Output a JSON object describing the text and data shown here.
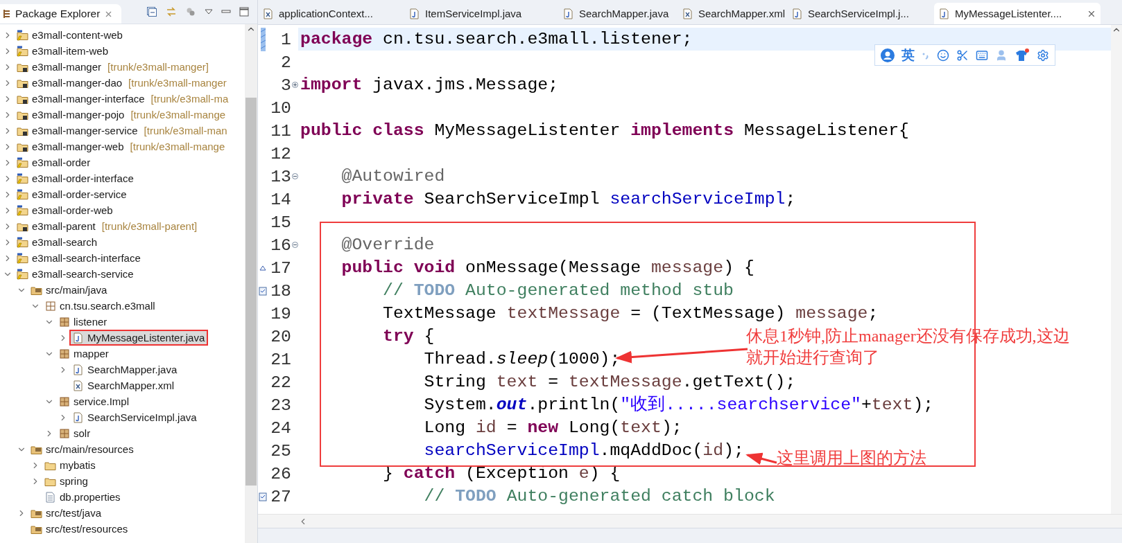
{
  "explorer": {
    "title": "Package Explorer",
    "tree": [
      {
        "label": "e3mall-content-web",
        "kind": "maven-project",
        "expanded": false
      },
      {
        "label": "e3mall-item-web",
        "kind": "maven-project",
        "expanded": false
      },
      {
        "label": "e3mall-manger",
        "decoration": "[trunk/e3mall-manger]",
        "kind": "svn-project",
        "expanded": false
      },
      {
        "label": "e3mall-manger-dao",
        "decoration": "[trunk/e3mall-manger",
        "kind": "svn-project",
        "expanded": false
      },
      {
        "label": "e3mall-manger-interface",
        "decoration": "[trunk/e3mall-ma",
        "kind": "svn-project",
        "expanded": false
      },
      {
        "label": "e3mall-manger-pojo",
        "decoration": "[trunk/e3mall-mange",
        "kind": "svn-project",
        "expanded": false
      },
      {
        "label": "e3mall-manger-service",
        "decoration": "[trunk/e3mall-man",
        "kind": "svn-project",
        "expanded": false
      },
      {
        "label": "e3mall-manger-web",
        "decoration": "[trunk/e3mall-mange",
        "kind": "svn-project",
        "expanded": false
      },
      {
        "label": "e3mall-order",
        "kind": "maven-project",
        "expanded": false
      },
      {
        "label": "e3mall-order-interface",
        "kind": "maven-project",
        "expanded": false
      },
      {
        "label": "e3mall-order-service",
        "kind": "maven-project",
        "expanded": false
      },
      {
        "label": "e3mall-order-web",
        "kind": "maven-project",
        "expanded": false
      },
      {
        "label": "e3mall-parent",
        "decoration": "[trunk/e3mall-parent]",
        "kind": "svn-project",
        "expanded": false
      },
      {
        "label": "e3mall-search",
        "kind": "maven-project",
        "expanded": false
      },
      {
        "label": "e3mall-search-interface",
        "kind": "maven-project",
        "expanded": false
      },
      {
        "label": "e3mall-search-service",
        "kind": "maven-project",
        "expanded": true,
        "children": [
          {
            "label": "src/main/java",
            "kind": "source-folder",
            "expanded": true,
            "children": [
              {
                "label": "cn.tsu.search.e3mall",
                "kind": "package-root",
                "expanded": true,
                "children": [
                  {
                    "label": "listener",
                    "kind": "package",
                    "expanded": true,
                    "children": [
                      {
                        "label": "MyMessageListenter.java",
                        "kind": "java",
                        "expanded": false,
                        "selected": true,
                        "boxed": true
                      }
                    ]
                  },
                  {
                    "label": "mapper",
                    "kind": "package",
                    "expanded": true,
                    "children": [
                      {
                        "label": "SearchMapper.java",
                        "kind": "java",
                        "expanded": false,
                        "selected": false,
                        "boxed": false
                      },
                      {
                        "label": "SearchMapper.xml",
                        "kind": "xml",
                        "selected": false,
                        "boxed": false
                      }
                    ]
                  },
                  {
                    "label": "service.Impl",
                    "kind": "package",
                    "expanded": true,
                    "children": [
                      {
                        "label": "SearchServiceImpl.java",
                        "kind": "java",
                        "expanded": false,
                        "selected": false,
                        "boxed": false
                      }
                    ]
                  },
                  {
                    "label": "solr",
                    "kind": "package",
                    "expanded": false
                  }
                ]
              }
            ]
          },
          {
            "label": "src/main/resources",
            "kind": "source-folder",
            "expanded": true,
            "children": [
              {
                "label": "mybatis",
                "kind": "folder",
                "expanded": false
              },
              {
                "label": "spring",
                "kind": "folder",
                "expanded": false
              },
              {
                "label": "db.properties",
                "kind": "file"
              }
            ]
          },
          {
            "label": "src/test/java",
            "kind": "source-folder",
            "expanded": false
          },
          {
            "label": "src/test/resources",
            "kind": "source-folder"
          }
        ]
      }
    ]
  },
  "editor": {
    "tabs": [
      {
        "label": "applicationContext...",
        "kind": "xml",
        "selected": false
      },
      {
        "label": "ItemServiceImpl.java",
        "kind": "java",
        "selected": false
      },
      {
        "label": "SearchMapper.java",
        "kind": "java",
        "selected": false
      },
      {
        "label": "SearchMapper.xml",
        "kind": "xml",
        "selected": false
      },
      {
        "label": "SearchServiceImpl.j...",
        "kind": "java",
        "selected": false
      },
      {
        "label": "MyMessageListenter....",
        "kind": "java",
        "selected": true
      }
    ],
    "lines": [
      {
        "number": "1",
        "current": true,
        "tokens": [
          {
            "text": "package",
            "kind": "keyword"
          },
          {
            "text": " cn.tsu.search.e3mall.listener;",
            "kind": "plain"
          }
        ]
      },
      {
        "number": "2",
        "current": false
      },
      {
        "number": "3",
        "current": false,
        "folded": true,
        "tokens": [
          {
            "text": "import",
            "kind": "keyword"
          },
          {
            "text": " javax.jms.Message;",
            "kind": "plain"
          }
        ]
      },
      {
        "number": "10",
        "current": false
      },
      {
        "number": "11",
        "current": false,
        "tokens": [
          {
            "text": "public class",
            "kind": "keyword"
          },
          {
            "text": " MyMessageListenter ",
            "kind": "plain"
          },
          {
            "text": "implements",
            "kind": "keyword"
          },
          {
            "text": " MessageListener{",
            "kind": "plain"
          }
        ]
      },
      {
        "number": "12",
        "current": false
      },
      {
        "number": "13",
        "current": false,
        "folded": false,
        "tokens": [
          {
            "text": "    @Autowired",
            "kind": "annotation"
          }
        ]
      },
      {
        "number": "14",
        "current": false,
        "tokens": [
          {
            "text": "    private",
            "kind": "keyword"
          },
          {
            "text": " SearchServiceImpl ",
            "kind": "plain"
          },
          {
            "text": "searchServiceImpl",
            "kind": "field"
          },
          {
            "text": ";",
            "kind": "plain"
          }
        ]
      },
      {
        "number": "15",
        "current": false
      },
      {
        "number": "16",
        "current": false,
        "folded": false,
        "tokens": [
          {
            "text": "    @Override",
            "kind": "annotation"
          }
        ]
      },
      {
        "number": "17",
        "current": false,
        "overrides": true,
        "tokens": [
          {
            "text": "    public void",
            "kind": "keyword"
          },
          {
            "text": " onMessage(Message ",
            "kind": "plain"
          },
          {
            "text": "message",
            "kind": "local"
          },
          {
            "text": ") {",
            "kind": "plain"
          }
        ]
      },
      {
        "number": "18",
        "current": false,
        "task": true,
        "tokens": [
          {
            "text": "        // ",
            "kind": "comment"
          },
          {
            "text": "TODO",
            "kind": "todo"
          },
          {
            "text": " Auto-generated method stub",
            "kind": "comment"
          }
        ]
      },
      {
        "number": "19",
        "current": false,
        "tokens": [
          {
            "text": "        TextMessage ",
            "kind": "plain"
          },
          {
            "text": "textMessage",
            "kind": "local"
          },
          {
            "text": " = (TextMessage) ",
            "kind": "plain"
          },
          {
            "text": "message",
            "kind": "local"
          },
          {
            "text": ";",
            "kind": "plain"
          }
        ]
      },
      {
        "number": "20",
        "current": false,
        "tokens": [
          {
            "text": "        try",
            "kind": "keyword"
          },
          {
            "text": " {",
            "kind": "plain"
          }
        ]
      },
      {
        "number": "21",
        "current": false,
        "tokens": [
          {
            "text": "            Thread.",
            "kind": "plain"
          },
          {
            "text": "sleep",
            "kind": "static-method"
          },
          {
            "text": "(1000);",
            "kind": "plain"
          }
        ]
      },
      {
        "number": "22",
        "current": false,
        "tokens": [
          {
            "text": "            String ",
            "kind": "plain"
          },
          {
            "text": "text",
            "kind": "local"
          },
          {
            "text": " = ",
            "kind": "plain"
          },
          {
            "text": "textMessage",
            "kind": "local"
          },
          {
            "text": ".getText();",
            "kind": "plain"
          }
        ]
      },
      {
        "number": "23",
        "current": false,
        "tokens": [
          {
            "text": "            System.",
            "kind": "plain"
          },
          {
            "text": "out",
            "kind": "static-field"
          },
          {
            "text": ".println(",
            "kind": "plain"
          },
          {
            "text": "\"收到.....searchservice\"",
            "kind": "string"
          },
          {
            "text": "+",
            "kind": "plain"
          },
          {
            "text": "text",
            "kind": "local"
          },
          {
            "text": ");",
            "kind": "plain"
          }
        ]
      },
      {
        "number": "24",
        "current": false,
        "tokens": [
          {
            "text": "            Long ",
            "kind": "plain"
          },
          {
            "text": "id",
            "kind": "local"
          },
          {
            "text": " = ",
            "kind": "plain"
          },
          {
            "text": "new",
            "kind": "keyword"
          },
          {
            "text": " Long(",
            "kind": "plain"
          },
          {
            "text": "text",
            "kind": "local"
          },
          {
            "text": ");",
            "kind": "plain"
          }
        ]
      },
      {
        "number": "25",
        "current": false,
        "tokens": [
          {
            "text": "            searchServiceImpl",
            "kind": "field"
          },
          {
            "text": ".mqAddDoc(",
            "kind": "plain"
          },
          {
            "text": "id",
            "kind": "local"
          },
          {
            "text": ");",
            "kind": "plain"
          }
        ]
      },
      {
        "number": "26",
        "current": false,
        "tokens": [
          {
            "text": "        } ",
            "kind": "plain"
          },
          {
            "text": "catch",
            "kind": "keyword"
          },
          {
            "text": " (Exception ",
            "kind": "plain"
          },
          {
            "text": "e",
            "kind": "local"
          },
          {
            "text": ") {",
            "kind": "plain"
          }
        ]
      },
      {
        "number": "27",
        "current": false,
        "task": true,
        "tokens": [
          {
            "text": "            // ",
            "kind": "comment"
          },
          {
            "text": "TODO",
            "kind": "todo"
          },
          {
            "text": " Auto-generated catch block",
            "kind": "comment"
          }
        ]
      }
    ],
    "callouts": [
      {
        "lines": [
          "休息1秒钟,防止manager还没有保存成功,这边",
          "就开始进行查询了"
        ]
      },
      {
        "lines": [
          "这里调用上图的方法"
        ]
      }
    ]
  },
  "ime_toolbar": {
    "language": "英"
  }
}
